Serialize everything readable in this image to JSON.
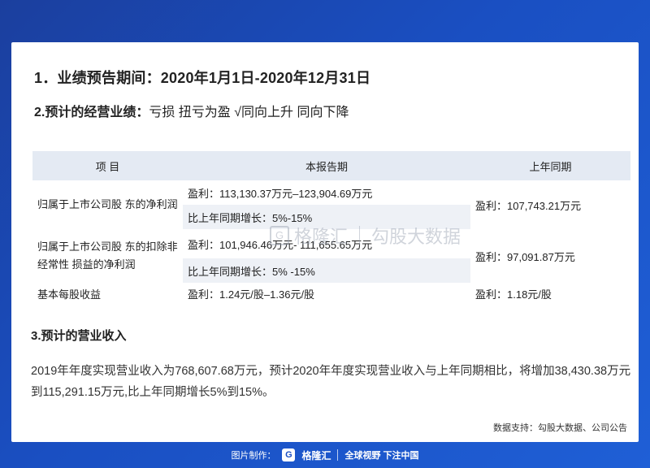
{
  "heading1": "1．业绩预告期间：2020年1月1日-2020年12月31日",
  "heading2": {
    "label": "2.预计的经营业绩：",
    "options": "亏损 扭亏为盈 √同向上升 同向下降"
  },
  "table": {
    "headers": [
      "项 目",
      "本报告期",
      "上年同期"
    ],
    "rows": [
      {
        "label": "归属于上市公司股 东的净利润",
        "current_profit": "盈利：113,130.37万元–123,904.69万元",
        "current_growth": "比上年同期增长：5%-15%",
        "previous": "盈利：107,743.21万元"
      },
      {
        "label_line1": "归属于上市公司股 东的扣除非",
        "label_line2": "经常性 损益的净利润",
        "current_profit": "盈利：101,946.46万元- 111,655.65万元",
        "current_growth": "比上年同期增长：5% -15%",
        "previous": "盈利：97,091.87万元"
      },
      {
        "label": "基本每股收益",
        "current": "盈利：1.24元/股–1.36元/股",
        "previous": "盈利：1.18元/股"
      }
    ]
  },
  "heading3": "3.预计的营业收入",
  "paragraph": "2019年年度实现营业收入为768,607.68万元，预计2020年年度实现营业收入与上年同期相比，将增加38,430.38万元到115,291.15万元,比上年同期增长5%到15%。",
  "source": "数据支持：勾股大数据、公司公告",
  "watermark": {
    "logo": "G",
    "brand": "格隆汇",
    "text": "勾股大数据"
  },
  "footer": {
    "made_by": "图片制作：",
    "logo_letter": "G",
    "brand": "格隆汇",
    "slogan": "全球视野 下注中国"
  },
  "colors": {
    "background": "#1a4fc2",
    "table_header": "#e4eaf3",
    "table_shade": "#eef1f6"
  }
}
